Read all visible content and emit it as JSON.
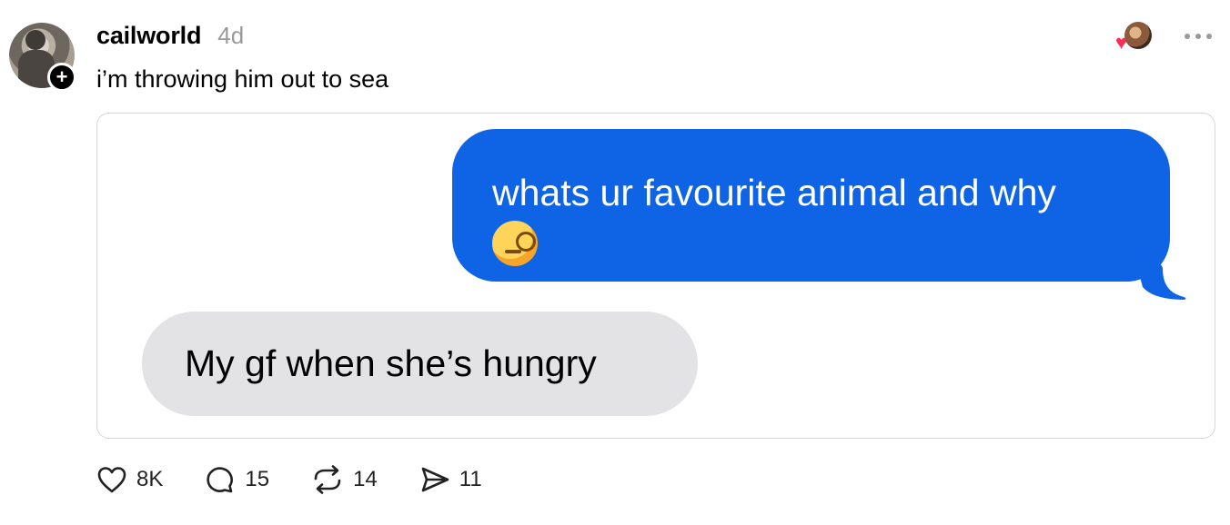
{
  "post": {
    "username": "cailworld",
    "time": "4d",
    "caption": "i’m throwing him out to sea",
    "media": {
      "sent_message": "whats ur favourite animal and why",
      "sent_emoji": "face-with-monocle",
      "received_message": "My gf when she’s hungry"
    },
    "actions": {
      "likes": "8K",
      "replies": "15",
      "reposts": "14",
      "shares": "11"
    }
  },
  "colors": {
    "imessage_blue": "#0f64e6",
    "received_gray": "#e3e3e5",
    "heart_red": "#ff2d55",
    "meta_gray": "#9a9a9a"
  }
}
